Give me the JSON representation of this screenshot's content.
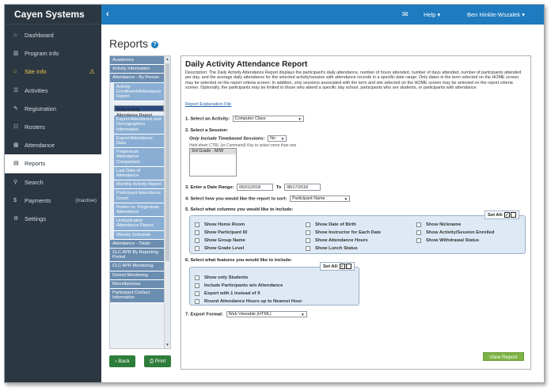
{
  "brand": "Cayen Systems",
  "topbar": {
    "collapse": "‹",
    "mail": "✉",
    "help": "Help ▾",
    "user": "Ben Hinkle-Wszalek ▾"
  },
  "sidebar": {
    "items": [
      {
        "icon": "⌂",
        "label": "Dashboard"
      },
      {
        "icon": "▥",
        "label": "Program Info"
      },
      {
        "icon": "⌂",
        "label": "Site Info",
        "warning": "⚠"
      },
      {
        "icon": "☰",
        "label": "Activities"
      },
      {
        "icon": "✎",
        "label": "Registration"
      },
      {
        "icon": "☷",
        "label": "Rosters"
      },
      {
        "icon": "▦",
        "label": "Attendance"
      },
      {
        "icon": "▤",
        "label": "Reports"
      },
      {
        "icon": "⚲",
        "label": "Search"
      },
      {
        "icon": "$",
        "label": "Payments",
        "tag": "(Inactive)"
      },
      {
        "icon": "⚙",
        "label": "Settings"
      }
    ]
  },
  "page": {
    "title": "Reports",
    "help": "?"
  },
  "report_list": [
    {
      "label": "Academics",
      "type": "cat"
    },
    {
      "label": "Activity Information",
      "type": "cat"
    },
    {
      "label": "Attendance - By Person",
      "type": "cat"
    },
    {
      "label": "Activity Enrollment/Attendance Report",
      "type": "sub"
    },
    {
      "label": "Daily Activity Attendance Report",
      "type": "sel"
    },
    {
      "label": "Export Attendance and Demographics Information",
      "type": "sub"
    },
    {
      "label": "Export Attendance Data",
      "type": "sub"
    },
    {
      "label": "Fingerscan Attendance Comparison",
      "type": "sub"
    },
    {
      "label": "Last Date of Attendance",
      "type": "sub"
    },
    {
      "label": "Monthly Activity Report",
      "type": "sub"
    },
    {
      "label": "Participant Attendance Count",
      "type": "sub"
    },
    {
      "label": "Roster vs. Fingerscan Attendance",
      "type": "sub"
    },
    {
      "label": "Unduplicated Attendance Report",
      "type": "sub"
    },
    {
      "label": "Weekly Schedule",
      "type": "sub"
    },
    {
      "label": "Attendance - Totals",
      "type": "cat"
    },
    {
      "label": "CLC APR By Reporting Period",
      "type": "cat"
    },
    {
      "label": "CLC APR Monitoring",
      "type": "cat"
    },
    {
      "label": "District Monitoring",
      "type": "cat"
    },
    {
      "label": "Miscellaneous",
      "type": "cat"
    },
    {
      "label": "Participant Contact Information",
      "type": "cat"
    }
  ],
  "buttons": {
    "back": "‹ Back",
    "print": "⎙ Print",
    "view_report": "View Report"
  },
  "report": {
    "title": "Daily Activity Attendance Report",
    "description": "Description: The Daily Activity Attendance Report displays the participant's daily attendance, number of hours attended, number of days attended, number of participants attended per day, and the average daily attendance for the selected activity/session with attendance records in a specific date range. Only dates in the term selected on the HOME screen may be selected on the report criteria screen. In addition, only sessions associated with the term and site selected on the HOME screen may be selected on the report criteria screen. Optionally, the participants may be limited to those who attend a specific day school, participants who are students, or participants with attendance.",
    "explanation_link": "Report Explanation File",
    "step1_label": "1. Select an Activity:",
    "activity_value": "Computer Class",
    "step2_label": "2. Select a Session:",
    "timebased_label": "Only Include Timebased Sessions:",
    "timebased_value": "No",
    "hold_hint": "Hold down CTRL (or Command) Key to select more than one",
    "session_option": "3rd Grade - M/W",
    "step3_label": "3. Enter a Date Range:",
    "date_from": "06/01/2018",
    "date_to_label": "To",
    "date_to": "08/17/2018",
    "step4_label": "4. Select how you would like the report to sort:",
    "sort_value": "Participant Name",
    "step5_label": "5. Select what columns you would like to include:",
    "set_all": "Set All:",
    "columns": [
      "Show Home Room",
      "Show Participant ID",
      "Show Group Name",
      "Show Grade Level",
      "Show Date of Birth",
      "Show Instructor for Each Date",
      "Show Attendance Hours",
      "Show Lunch Status",
      "Show Nickname",
      "Show Activity/Session Enrolled",
      "Show Withdrawal Status"
    ],
    "step6_label": "6. Select what features you would like to include:",
    "features": [
      "Show only Students",
      "Include Participants w/o Attendance",
      "Export with 1 instead of X",
      "Round Attendance Hours up to Nearest Hour"
    ],
    "step7_label": "7. Export Format:",
    "export_value": "Web Viewable (HTML)"
  }
}
